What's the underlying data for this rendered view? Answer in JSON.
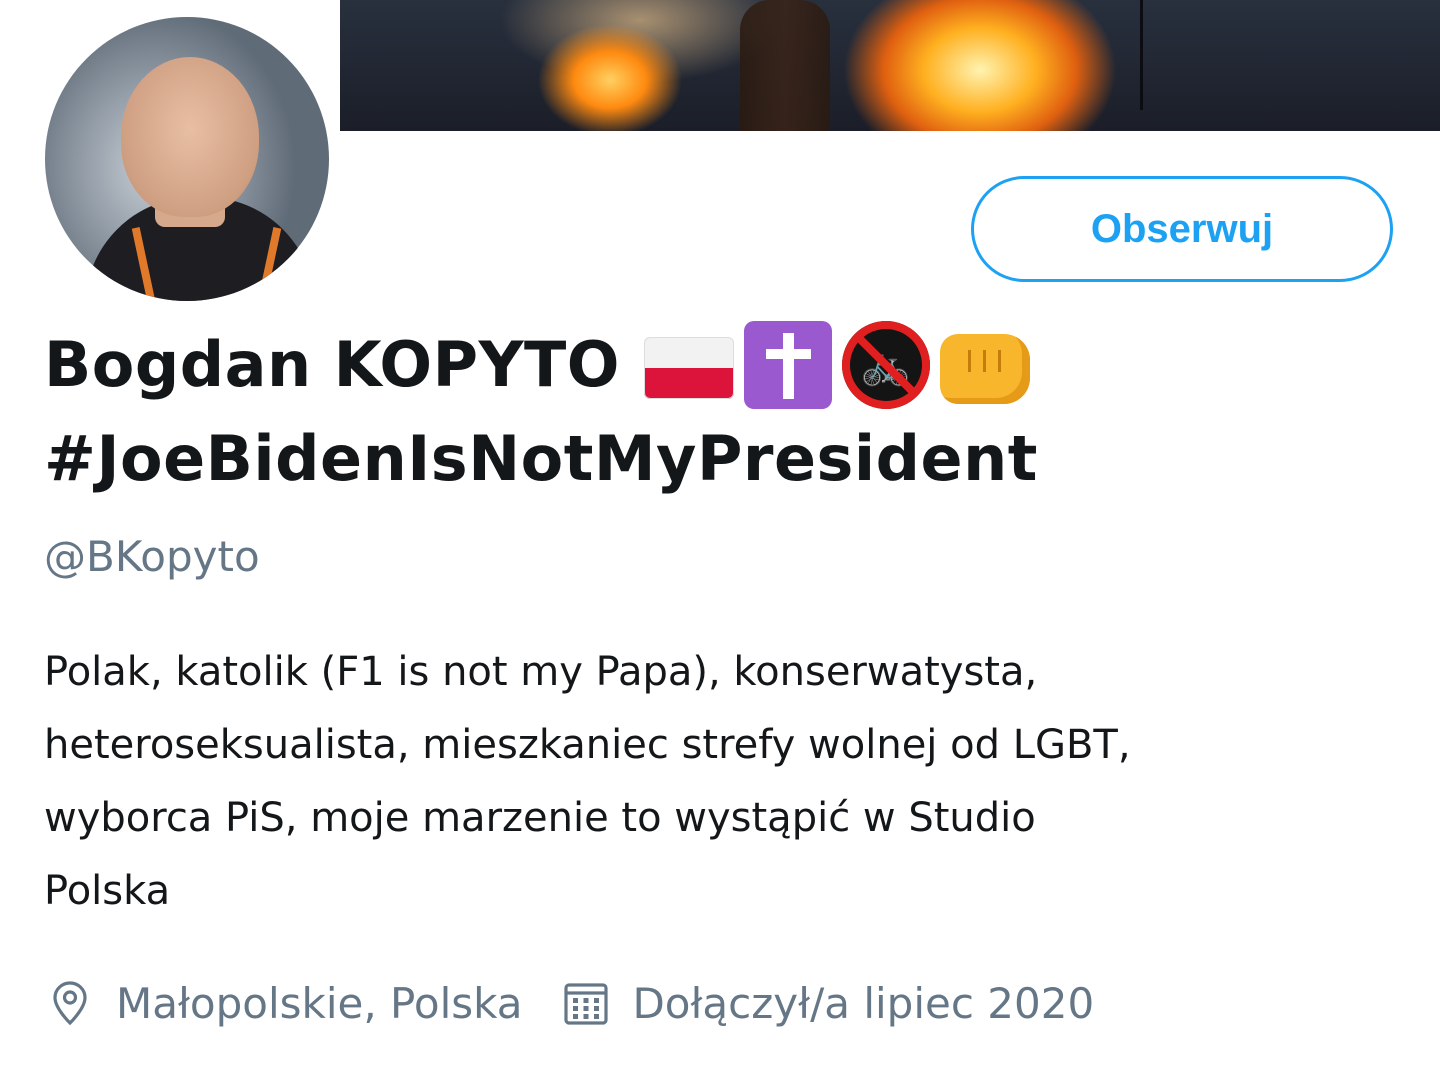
{
  "profile": {
    "display_name_line1": "Bogdan KOPYTO",
    "display_name_line2": "#JoeBidenIsNotMyPresident",
    "name_emojis": [
      "flag-poland",
      "latin-cross",
      "no-bicycles",
      "oncoming-fist"
    ],
    "handle": "@BKopyto",
    "bio_lines": [
      "Polak, katolik (F1 is not my Papa), konserwatysta,",
      "heteroseksualista, mieszkaniec strefy wolnej od LGBT,",
      "wyborca PiS, moje marzenie to wystąpić w Studio",
      "Polska"
    ],
    "location": "Małopolskie, Polska",
    "joined": "Dołączył/a lipiec 2020"
  },
  "actions": {
    "follow_label": "Obserwuj"
  },
  "colors": {
    "accent": "#1da1f2",
    "text_primary": "#14171a",
    "text_secondary": "#657786",
    "background": "#ffffff"
  },
  "icons": {
    "location": "location-pin-icon",
    "joined": "calendar-icon"
  }
}
